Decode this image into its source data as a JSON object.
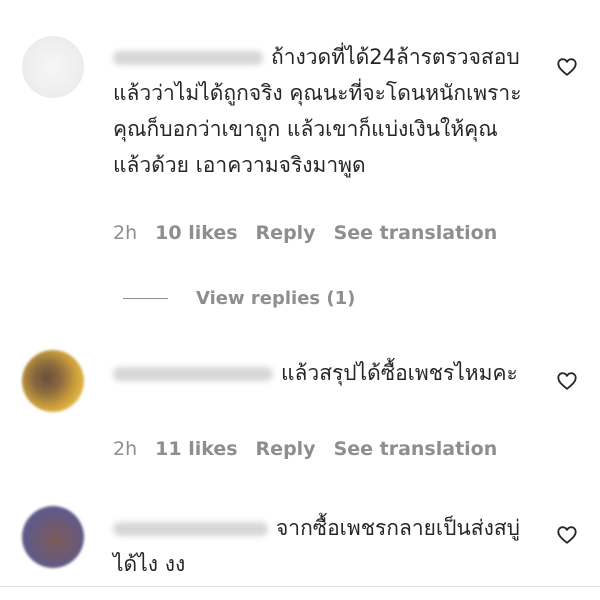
{
  "comments": [
    {
      "avatar": "blank-avatar",
      "text": "ถ้างวดที่ได้24ล้ารตรวจสอบแล้วว่าไม่ได้ถูกจริง คุณนะที่จะโดนหนักเพราะคุณก็บอกว่าเขาถูก แล้วเขาก็แบ่งเงินให้คุณแล้วด้วย เอาความจริงมาพูด",
      "time": "2h",
      "likes": "10 likes",
      "reply": "Reply",
      "translate": "See translation"
    },
    {
      "avatar": "gold-avatar",
      "text": "แล้วสรุปได้ซื้อเพชรไหมคะ",
      "time": "2h",
      "likes": "11 likes",
      "reply": "Reply",
      "translate": "See translation"
    },
    {
      "avatar": "purple-avatar",
      "text": "จากซื้อเพชรกลายเป็นส่งสบู่ได้ไง งง"
    }
  ],
  "view_replies": "View replies (1)",
  "colors": {
    "text": "#262626",
    "secondary": "#8e8e8e",
    "background": "#ffffff"
  },
  "icons": {
    "like": "heart-outline-icon"
  }
}
